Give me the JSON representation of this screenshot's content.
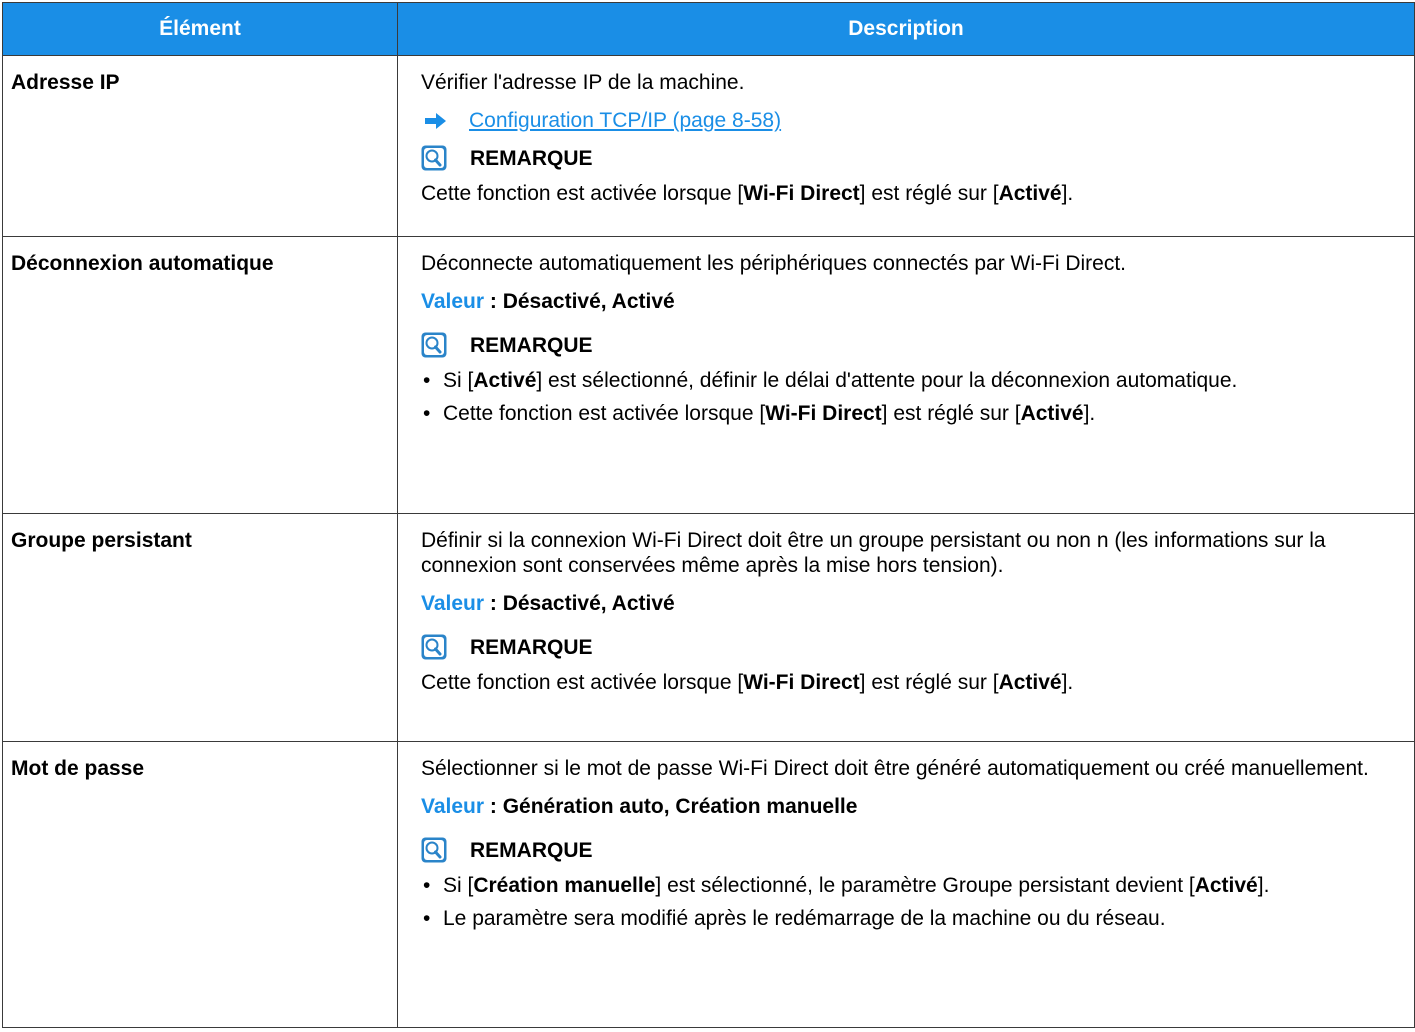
{
  "table": {
    "header": {
      "col1": "Élément",
      "col2": "Description"
    },
    "rows": [
      {
        "item": "Adresse IP",
        "description": "Vérifier l'adresse IP de la machine.",
        "link": "Configuration TCP/IP (page 8-58)",
        "note_title": "REMARQUE",
        "note_pre": "Cette fonction est activée lorsque [",
        "note_b1": "Wi-Fi Direct",
        "note_mid": "] est réglé sur [",
        "note_b2": "Activé",
        "note_post": "]."
      },
      {
        "item": "Déconnexion automatique",
        "description": "Déconnecte automatiquement les périphériques connectés par Wi-Fi Direct.",
        "value_label": "Valeur",
        "value_text": " : Désactivé, Activé",
        "note_title": "REMARQUE",
        "bullet1_pre": "Si [",
        "bullet1_b": "Activé",
        "bullet1_post": "] est sélectionné, définir le délai d'attente pour la déconnexion automatique.",
        "bullet2_pre": "Cette fonction est activée lorsque [",
        "bullet2_b1": "Wi-Fi Direct",
        "bullet2_mid": "] est réglé sur [",
        "bullet2_b2": "Activé",
        "bullet2_post": "]."
      },
      {
        "item": "Groupe persistant",
        "description": "Définir si la connexion Wi-Fi Direct doit être un groupe persistant ou non n (les informations sur la connexion sont conservées même après la mise hors tension).",
        "value_label": "Valeur",
        "value_text": " : Désactivé, Activé",
        "note_title": "REMARQUE",
        "note_pre": "Cette fonction est activée lorsque [",
        "note_b1": "Wi-Fi Direct",
        "note_mid": "] est réglé sur [",
        "note_b2": "Activé",
        "note_post": "]."
      },
      {
        "item": "Mot de passe",
        "description": "Sélectionner si le mot de passe Wi-Fi Direct doit être généré automatiquement ou créé manuellement.",
        "value_label": "Valeur",
        "value_text": " : Génération auto, Création manuelle",
        "note_title": "REMARQUE",
        "bullet1_pre": "Si [",
        "bullet1_b": "Création manuelle",
        "bullet1_mid": "] est sélectionné, le paramètre Groupe persistant devient [",
        "bullet1_b2": "Activé",
        "bullet1_post": "].",
        "bullet2": "Le paramètre sera modifié après le redémarrage de la machine ou du réseau."
      }
    ],
    "bullet_char": "•",
    "colors": {
      "header_bg": "#1a8ee6",
      "accent": "#1a8ee6",
      "border": "#3a3a3a"
    },
    "icons": {
      "reference": "arrow-right-icon",
      "note": "lightbulb-note-icon"
    }
  }
}
